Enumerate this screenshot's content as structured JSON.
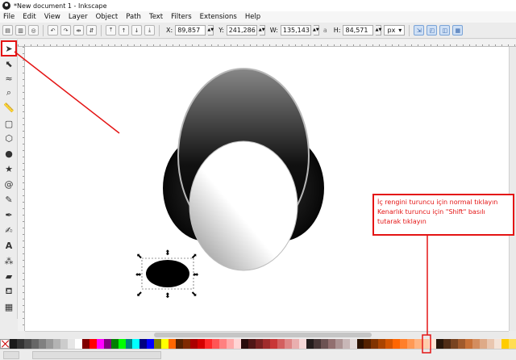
{
  "window": {
    "title": "*New document 1 - Inkscape"
  },
  "menu": [
    "File",
    "Edit",
    "View",
    "Layer",
    "Object",
    "Path",
    "Text",
    "Filters",
    "Extensions",
    "Help"
  ],
  "controls": {
    "x_label": "X:",
    "x_value": "89,857",
    "y_label": "Y:",
    "y_value": "241,286",
    "w_label": "W:",
    "w_value": "135,143",
    "h_label": "H:",
    "h_value": "84,571",
    "unit": "px"
  },
  "annotation": {
    "line1": "İç rengini turuncu için normal tıklayın",
    "line2": "Kenarlık turuncu için \"Shift\" basılı",
    "line3": "tutarak tıklayın",
    "color": "#e41414"
  },
  "icons": {
    "app": "inkscape-logo-icon",
    "tools": [
      "selector-tool-icon",
      "node-tool-icon",
      "tweak-tool-icon",
      "zoom-tool-icon",
      "measure-tool-icon",
      "rectangle-tool-icon",
      "3d-box-tool-icon",
      "ellipse-tool-icon",
      "star-tool-icon",
      "spiral-tool-icon",
      "pencil-tool-icon",
      "pen-tool-icon",
      "calligraphy-tool-icon",
      "text-tool-icon",
      "spray-tool-icon",
      "eraser-tool-icon",
      "bucket-tool-icon",
      "gradient-tool-icon"
    ]
  },
  "palette": [
    "#1a1a1a",
    "#333333",
    "#4d4d4d",
    "#666666",
    "#808080",
    "#999999",
    "#b3b3b3",
    "#cccccc",
    "#e6e6e6",
    "#ffffff",
    "#800000",
    "#ff0000",
    "#ff00ff",
    "#800080",
    "#008000",
    "#00ff00",
    "#008080",
    "#00ffff",
    "#000080",
    "#0000ff",
    "#808000",
    "#ffff00",
    "#ff6600",
    "#552200",
    "#7f2a00",
    "#aa0000",
    "#d40000",
    "#ff2a2a",
    "#ff5555",
    "#ff8080",
    "#ffaaaa",
    "#ffd5d5",
    "#280b0b",
    "#501616",
    "#782121",
    "#a02c2c",
    "#c83737",
    "#d35f5f",
    "#de8787",
    "#e9afaf",
    "#f4d7d7",
    "#241c1c",
    "#483737",
    "#6c5353",
    "#916f6f",
    "#ac9393",
    "#c8b7b7",
    "#e3dbdb",
    "#2b1100",
    "#552200",
    "#803300",
    "#aa4400",
    "#d45500",
    "#ff6600",
    "#ff7f2a",
    "#ff9955",
    "#ffb380",
    "#ffccaa",
    "#ffe6d5",
    "#28170b",
    "#502d16",
    "#784421",
    "#a05a2c",
    "#c87137",
    "#d38d5f",
    "#deaa87",
    "#e9c6af",
    "#f4e3d7",
    "#ffcc00",
    "#ffdd55"
  ]
}
